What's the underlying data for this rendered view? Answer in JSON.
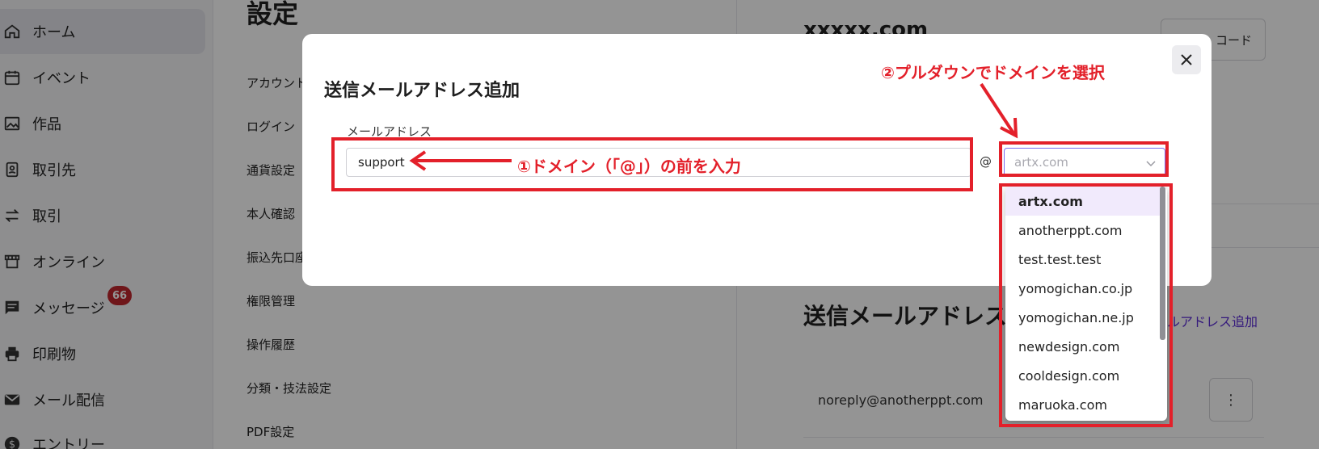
{
  "sidebar": {
    "items": [
      {
        "label": "ホーム",
        "icon": "home-icon",
        "active": true
      },
      {
        "label": "イベント",
        "icon": "calendar-icon"
      },
      {
        "label": "作品",
        "icon": "image-icon"
      },
      {
        "label": "取引先",
        "icon": "contact-icon"
      },
      {
        "label": "取引",
        "icon": "exchange-icon"
      },
      {
        "label": "オンライン",
        "icon": "store-icon"
      },
      {
        "label": "メッセージ",
        "icon": "message-icon",
        "badge": "66"
      },
      {
        "label": "印刷物",
        "icon": "printer-icon"
      },
      {
        "label": "メール配信",
        "icon": "mail-icon"
      },
      {
        "label": "エントリー",
        "icon": "dollar-icon"
      }
    ]
  },
  "settings": {
    "title": "設定",
    "items": [
      "アカウント",
      "ログイン",
      "通貨設定",
      "本人確認",
      "振込先口座",
      "権限管理",
      "操作履歴",
      "分類・技法設定",
      "PDF設定"
    ]
  },
  "right_panel": {
    "domain_heading": "xxxxx.com",
    "code_button_label": "コード",
    "sender_heading": "送信メールアドレス",
    "add_sender_link": "ルアドレス追加",
    "sender_email": "noreply@anotherppt.com",
    "more_button_label": "⋮"
  },
  "modal": {
    "title": "送信メールアドレス追加",
    "field_label": "メールアドレス",
    "email_value": "support",
    "at_sign": "@",
    "domain_placeholder": "artx.com"
  },
  "dropdown": {
    "options": [
      "artx.com",
      "anotherppt.com",
      "test.test.test",
      "yomogichan.co.jp",
      "yomogichan.ne.jp",
      "newdesign.com",
      "cooldesign.com",
      "maruoka.com"
    ],
    "selected_index": 0
  },
  "annotations": {
    "step1": "①ドメイン（「@」）の前を入力",
    "step2": "②プルダウンでドメインを選択"
  },
  "colors": {
    "annotation_red": "#e3202a",
    "brand_purple": "#4c1dd8",
    "badge_red": "#c0262d"
  }
}
